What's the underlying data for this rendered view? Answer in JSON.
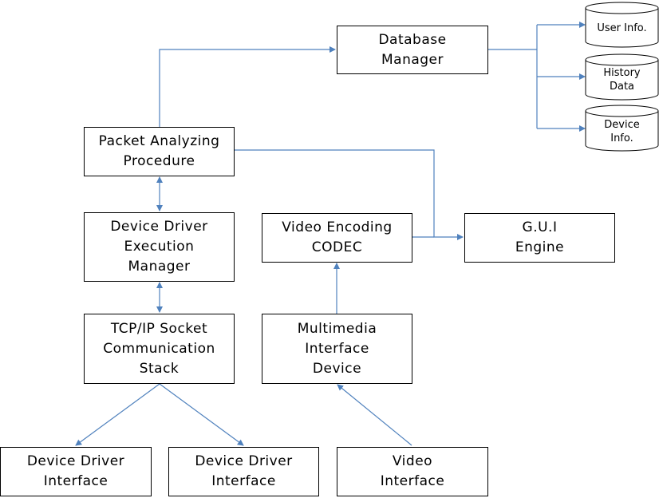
{
  "nodes": {
    "database_manager": [
      "Database",
      "Manager"
    ],
    "packet_analyzing": [
      "Packet Analyzing",
      "Procedure"
    ],
    "device_driver_exec": [
      "Device Driver",
      "Execution",
      "Manager"
    ],
    "tcpip": [
      "TCP/IP Socket",
      "Communication",
      "Stack"
    ],
    "video_encoding": [
      "Video Encoding",
      "CODEC"
    ],
    "multimedia": [
      "Multimedia",
      "Interface",
      "Device"
    ],
    "gui": [
      "G.U.I",
      "Engine"
    ],
    "ddi1": [
      "Device Driver",
      "Interface"
    ],
    "ddi2": [
      "Device Driver",
      "Interface"
    ],
    "video_interface": [
      "Video",
      "Interface"
    ]
  },
  "databases": {
    "user_info": [
      "User Info."
    ],
    "history": [
      "History",
      "Data"
    ],
    "device_info": [
      "Device",
      "Info."
    ]
  },
  "colors": {
    "edge": "#4f81bd",
    "border": "#000000"
  }
}
